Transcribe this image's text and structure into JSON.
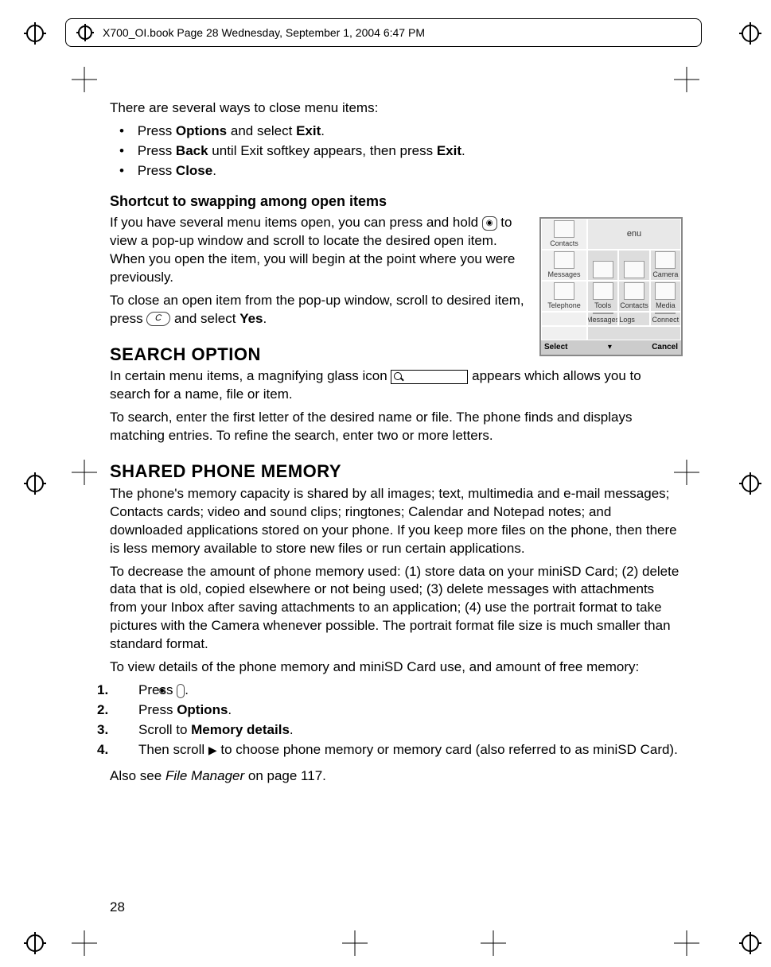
{
  "crop_header": "X700_OI.book  Page 28  Wednesday, September 1, 2004  6:47 PM",
  "page_number": "28",
  "intro": "There are several ways to close menu items:",
  "close_methods": [
    {
      "pre": "Press ",
      "b1": "Options",
      "mid": " and select ",
      "b2": "Exit",
      "post": "."
    },
    {
      "pre": "Press ",
      "b1": "Back",
      "mid": " until Exit softkey appears, then press ",
      "b2": "Exit",
      "post": "."
    },
    {
      "pre": "Press ",
      "b1": "Close",
      "mid": "",
      "b2": "",
      "post": "."
    }
  ],
  "h_shortcut": "Shortcut to swapping among open items",
  "shortcut_p1a": "If you have several menu items open, you can press and hold ",
  "shortcut_p1b": " to view a pop-up window and scroll to locate the desired open item. When you open the item, you will begin at the point where you were previously.",
  "shortcut_p2a": "To close an open item from the pop-up window, scroll to desired item, press ",
  "shortcut_p2_key": "C",
  "shortcut_p2b": " and select ",
  "shortcut_p2_bold": "Yes",
  "shortcut_p2c": ".",
  "h_search": "SEARCH OPTION",
  "search_p1a": "In certain menu items, a magnifying glass icon ",
  "search_p1b": " appears which allows you to search for a name, file or item.",
  "search_p2": "To search, enter the first letter of the desired name or file. The phone finds and displays matching entries. To refine the search, enter two or more letters.",
  "h_memory": "SHARED PHONE MEMORY",
  "mem_p1": "The phone's memory capacity is shared by all images; text, multimedia and e-mail messages; Contacts cards; video and sound clips; ringtones; Calendar and Notepad notes; and downloaded applications stored on your phone. If you keep more files on the phone, then there is less memory available to store new files or run certain applications.",
  "mem_p2": "To decrease the amount of phone memory used: (1) store data on your miniSD Card; (2) delete data that is old, copied elsewhere or not being used; (3) delete messages with attachments from your Inbox after saving attachments to an application; (4) use the portrait format to take pictures with the Camera whenever possible. The portrait format file size is much smaller than standard format.",
  "mem_p3": "To view details of the phone memory and miniSD Card use, and amount of free memory:",
  "mem_steps": [
    {
      "n": "1.",
      "pre": "Press ",
      "key": true,
      "post": "."
    },
    {
      "n": "2.",
      "pre": "Press ",
      "bold": "Options",
      "post": "."
    },
    {
      "n": "3.",
      "pre": "Scroll to ",
      "bold": "Memory details",
      "post": "."
    },
    {
      "n": "4.",
      "pre": "Then scroll ",
      "arrow": true,
      "post": " to choose phone memory or memory card (also referred to as miniSD Card)."
    }
  ],
  "also_see_pre": "Also see ",
  "also_see_italic": "File Manager",
  "also_see_post": " on page 117.",
  "fig": {
    "title": "enu",
    "side": [
      "Contacts",
      "Messages",
      "Telephone"
    ],
    "grid": [
      "",
      "",
      "Camera",
      "Tools",
      "Contacts",
      "Media",
      "Messages",
      "Call Logs",
      "Connect"
    ],
    "softkeys": [
      "Select",
      "",
      "Cancel"
    ]
  }
}
